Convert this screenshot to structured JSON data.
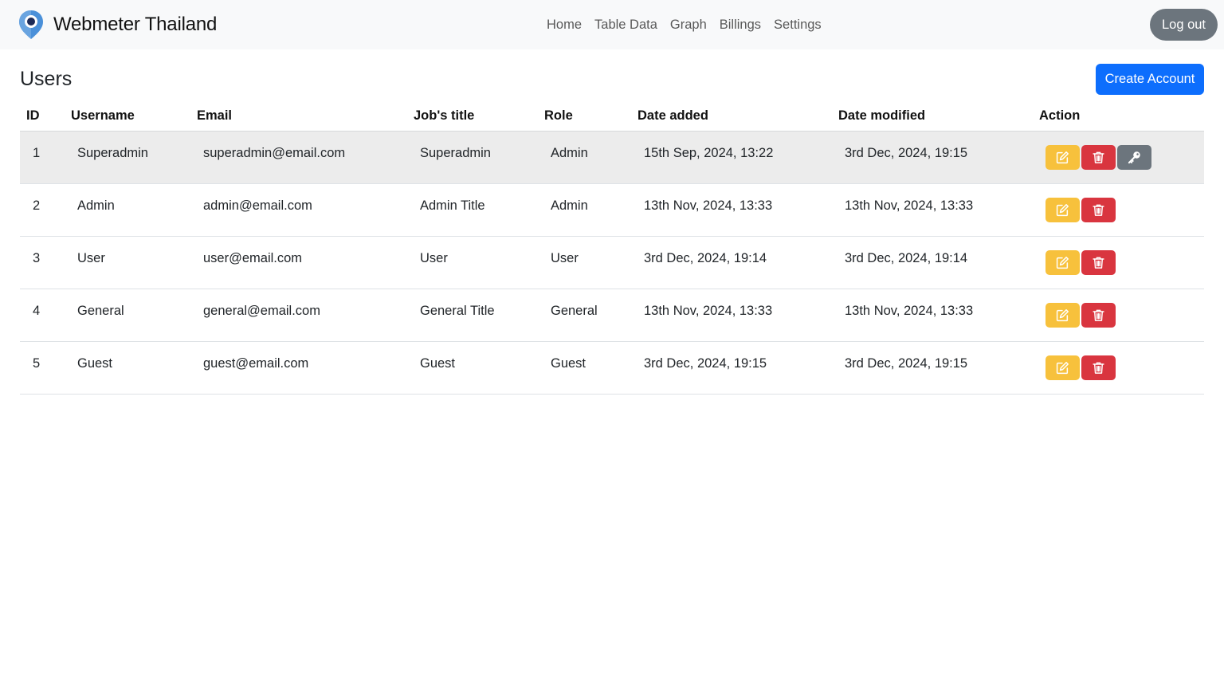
{
  "brand": {
    "name": "Webmeter Thailand",
    "logo_icon": "map-pin-logo-icon"
  },
  "nav": {
    "links": [
      "Home",
      "Table Data",
      "Graph",
      "Billings",
      "Settings"
    ]
  },
  "header": {
    "logout_label": "Log out"
  },
  "page": {
    "title": "Users",
    "create_label": "Create Account"
  },
  "table": {
    "columns": [
      "ID",
      "Username",
      "Email",
      "Job's title",
      "Role",
      "Date added",
      "Date modified",
      "Action"
    ],
    "rows": [
      {
        "id": "1",
        "username": "Superadmin",
        "email": "superadmin@email.com",
        "job_title": "Superadmin",
        "role": "Admin",
        "date_added": "15th Sep, 2024, 13:22",
        "date_modified": "3rd Dec, 2024, 19:15",
        "actions": [
          "edit",
          "delete",
          "key"
        ]
      },
      {
        "id": "2",
        "username": "Admin",
        "email": "admin@email.com",
        "job_title": "Admin Title",
        "role": "Admin",
        "date_added": "13th Nov, 2024, 13:33",
        "date_modified": "13th Nov, 2024, 13:33",
        "actions": [
          "edit",
          "delete"
        ]
      },
      {
        "id": "3",
        "username": "User",
        "email": "user@email.com",
        "job_title": "User",
        "role": "User",
        "date_added": "3rd Dec, 2024, 19:14",
        "date_modified": "3rd Dec, 2024, 19:14",
        "actions": [
          "edit",
          "delete"
        ]
      },
      {
        "id": "4",
        "username": "General",
        "email": "general@email.com",
        "job_title": "General Title",
        "role": "General",
        "date_added": "13th Nov, 2024, 13:33",
        "date_modified": "13th Nov, 2024, 13:33",
        "actions": [
          "edit",
          "delete"
        ]
      },
      {
        "id": "5",
        "username": "Guest",
        "email": "guest@email.com",
        "job_title": "Guest",
        "role": "Guest",
        "date_added": "3rd Dec, 2024, 19:15",
        "date_modified": "3rd Dec, 2024, 19:15",
        "actions": [
          "edit",
          "delete"
        ]
      }
    ],
    "highlighted_row": "1"
  },
  "icons": {
    "edit": "edit-icon",
    "delete": "trash-icon",
    "key": "key-icon"
  },
  "colors": {
    "primary": "#0d6efd",
    "secondary": "#6c757d",
    "warning": "#f7c13c",
    "danger": "#d9353f",
    "navbar_bg": "#f8f9fa",
    "row_highlight": "#ececec"
  }
}
